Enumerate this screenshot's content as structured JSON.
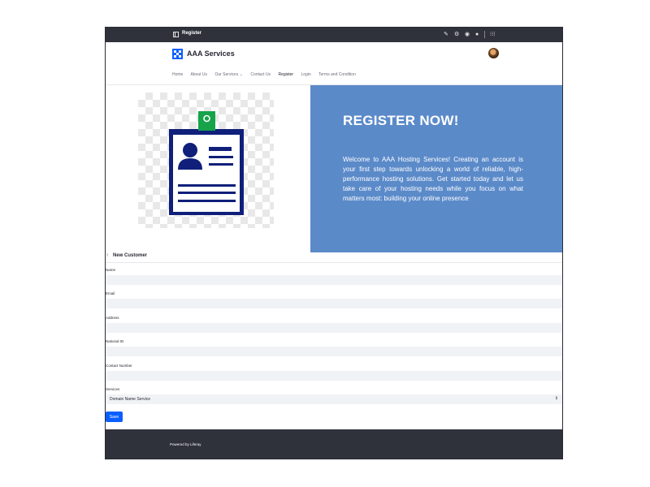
{
  "topbar": {
    "title": "Register",
    "icons": [
      "pencil-icon",
      "gear-icon",
      "globe-icon",
      "info-icon",
      "apps-grid-icon"
    ]
  },
  "header": {
    "brand": "AAA Services",
    "nav": [
      "Home",
      "About Us",
      "Our Services",
      "Contact Us",
      "Register",
      "Login",
      "Terms and Condition"
    ],
    "active_nav": "Register",
    "dropdown_caret": "⌄"
  },
  "hero": {
    "heading": "REGISTER NOW!",
    "body": "Welcome to AAA Hosting Services! Creating an account is your first step towards unlocking a world of reliable, high-performance hosting solutions. Get started today and let us take care of your hosting needs while you focus on what matters most: building your online presence"
  },
  "form": {
    "title": "New Customer",
    "back_icon": "‹",
    "fields": {
      "name": {
        "label": "Name",
        "value": ""
      },
      "email": {
        "label": "Email",
        "value": ""
      },
      "address": {
        "label": "Address",
        "value": ""
      },
      "national_id": {
        "label": "National ID",
        "value": ""
      },
      "contact": {
        "label": "Contact Number",
        "value": ""
      }
    },
    "services": {
      "label": "Services",
      "selected": "Domain Name Service",
      "arrows": "⇕"
    },
    "save_label": "Save"
  },
  "footer": {
    "text": "Powered by Liferay"
  },
  "colors": {
    "topbar": "#2f313b",
    "accent": "#0b5fff",
    "hero_bg": "#5b8ac9",
    "navy": "#0f1f7a",
    "clip_green": "#16a34a"
  }
}
